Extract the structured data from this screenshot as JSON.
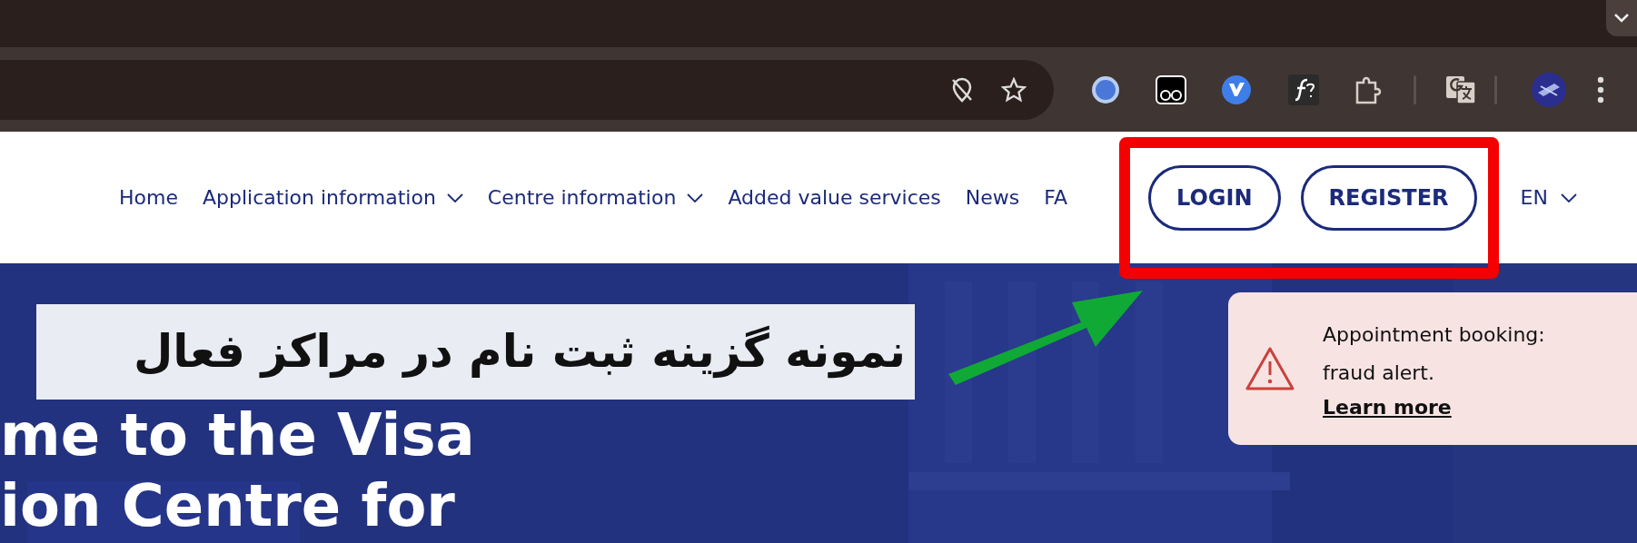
{
  "nav": {
    "items": [
      {
        "label": "Home",
        "dropdown": false
      },
      {
        "label": "Application information",
        "dropdown": true
      },
      {
        "label": "Centre information",
        "dropdown": true
      },
      {
        "label": "Added value services",
        "dropdown": false
      },
      {
        "label": "News",
        "dropdown": false
      },
      {
        "label": "FA",
        "dropdown": false
      }
    ],
    "buttons": [
      "LOGIN",
      "REGISTER"
    ],
    "language": "EN"
  },
  "annotation": {
    "caption": "نمونه گزینه ثبت نام در مراکز فعال"
  },
  "hero": {
    "title_lines": [
      "me to the Visa",
      "ion Centre for"
    ]
  },
  "alert": {
    "message": "Appointment booking: fraud alert.",
    "link": "Learn more"
  }
}
